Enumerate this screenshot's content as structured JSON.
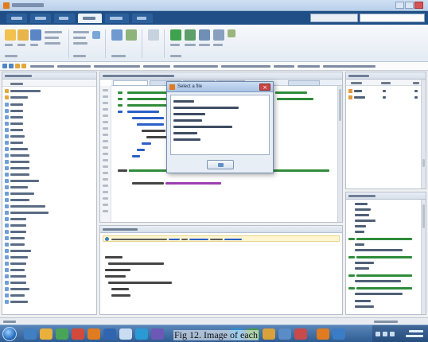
{
  "colors": {
    "tab_bar": "#1f4f86",
    "ribbon": "#e4ebf3",
    "dialog_title": "#a9c3e5",
    "close_button": "#c94646",
    "taskbar": "#2f5c92",
    "editor_keyword": "#2b5fc7",
    "editor_comment": "#2f8c3a",
    "editor_string": "#9b3fb0"
  },
  "dialog": {
    "title": "Select a file",
    "close_glyph": "×",
    "icon": "matlab-icon",
    "ok_icon": "ok-icon"
  },
  "caption": {
    "text": "Fig 12. Image of each"
  },
  "icons": {
    "start": "windows-start-icon",
    "close": "close-icon",
    "folder": "folder-icon",
    "file": "file-icon",
    "variable": "variable-icon",
    "info": "info-icon"
  }
}
